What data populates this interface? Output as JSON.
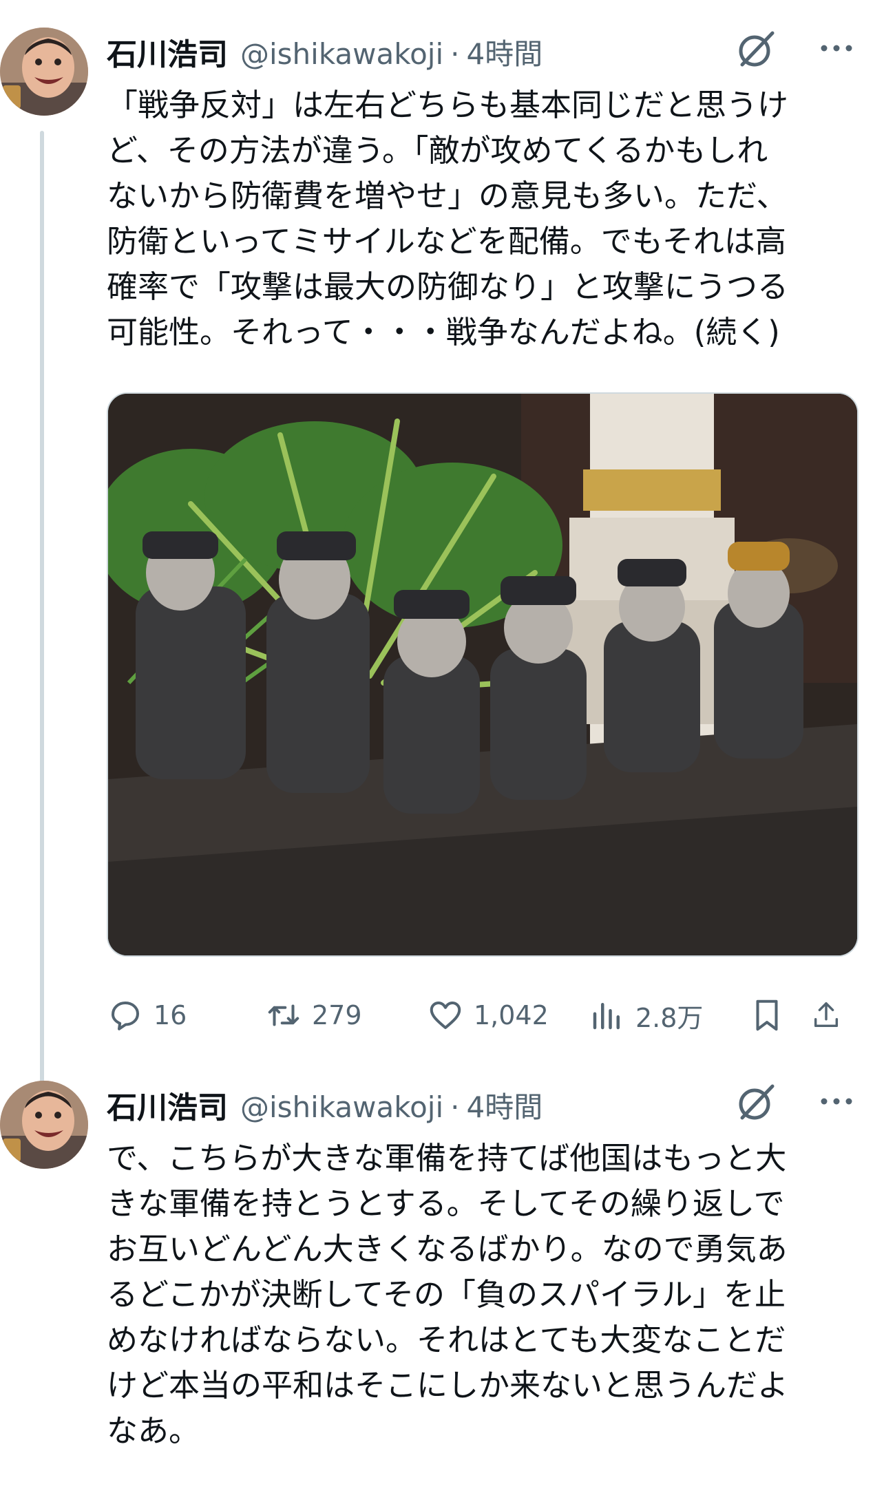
{
  "tweets": [
    {
      "display_name": "石川浩司",
      "handle": "@ishikawakoji",
      "separator": "·",
      "time": "4時間",
      "text": "「戦争反対」は左右どちらも基本同じだと思うけ\nど、その方法が違う。「敵が攻めてくるかもしれ\nないから防衛費を増やせ」の意見も多い。ただ、\n防衛といってミサイルなどを配備。でもそれは高\n確率で「攻撃は最大の防御なり」と攻撃にうつる\n可能性。それって・・・戦争なんだよね。(続く)",
      "stats": {
        "replies": "16",
        "retweets": "279",
        "likes": "1,042",
        "views": "2.8万"
      }
    },
    {
      "display_name": "石川浩司",
      "handle": "@ishikawakoji",
      "separator": "·",
      "time": "4時間",
      "text": "で、こちらが大きな軍備を持てば他国はもっと大\nきな軍備を持とうとする。そしてその繰り返しで\nお互いどんどん大きくなるばかり。なので勇気あ\nるどこかが決断してその「負のスパイラル」を止\nめなければならない。それはとても大変なことだ\nけど本当の平和はそこにしか来ないと思うんだよ\nなあ。"
    }
  ],
  "icons": {
    "grok": "grok-icon",
    "more": "more-icon",
    "reply": "reply-icon",
    "retweet": "retweet-icon",
    "like": "heart-icon",
    "views": "views-icon",
    "bookmark": "bookmark-icon",
    "share": "share-icon"
  },
  "colors": {
    "text": "#0f1419",
    "secondary": "#536471",
    "thread_line": "#cfd9de"
  }
}
